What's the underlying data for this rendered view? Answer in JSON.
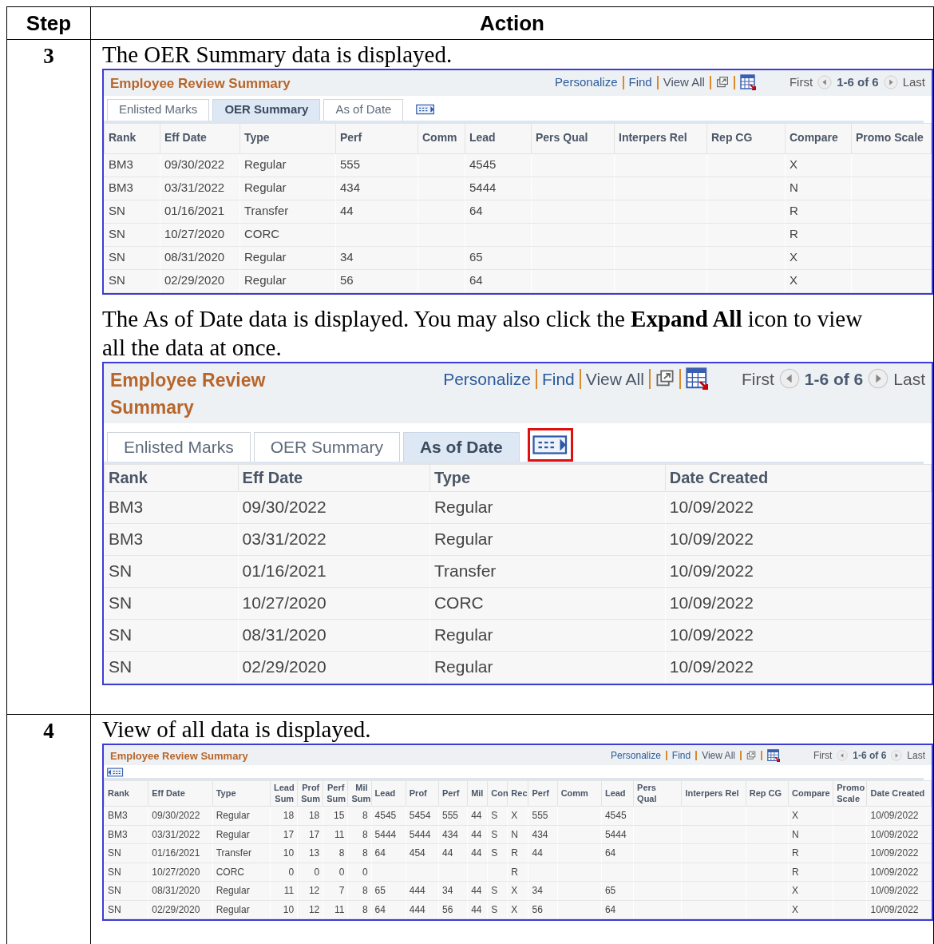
{
  "table": {
    "columns": [
      "Step",
      "Action"
    ],
    "rows": [
      {
        "step": "3",
        "content": [
          {
            "kind": "text",
            "text": "The OER Summary data is displayed."
          },
          {
            "kind": "grid",
            "title": "Employee Review Summary",
            "links": [
              "Personalize",
              "Find",
              "View All"
            ],
            "pager": {
              "first": "First",
              "range": "1-6 of 6",
              "last": "Last"
            },
            "tabs": [
              {
                "label": "Enlisted Marks",
                "selected": false
              },
              {
                "label": "OER Summary",
                "selected": true
              },
              {
                "label": "As of Date",
                "selected": false
              }
            ],
            "expand_highlighted": false,
            "columns": [
              {
                "label": "Rank"
              },
              {
                "label": "Eff Date"
              },
              {
                "label": "Type"
              },
              {
                "label": "Perf"
              },
              {
                "label": "Comm"
              },
              {
                "label": "Lead"
              },
              {
                "label": "Pers Qual"
              },
              {
                "label": "Interpers Rel"
              },
              {
                "label": "Rep CG"
              },
              {
                "label": "Compare"
              },
              {
                "label": "Promo Scale"
              }
            ],
            "rows": [
              [
                "BM3",
                "09/30/2022",
                "Regular",
                "555",
                null,
                "4545",
                null,
                null,
                null,
                "X",
                null
              ],
              [
                "BM3",
                "03/31/2022",
                "Regular",
                "434",
                null,
                "5444",
                null,
                null,
                null,
                "N",
                null
              ],
              [
                "SN",
                "01/16/2021",
                "Transfer",
                "44",
                null,
                "64",
                null,
                null,
                null,
                "R",
                null
              ],
              [
                "SN",
                "10/27/2020",
                "CORC",
                null,
                null,
                null,
                null,
                null,
                null,
                "R",
                null
              ],
              [
                "SN",
                "08/31/2020",
                "Regular",
                "34",
                null,
                "65",
                null,
                null,
                null,
                "X",
                null
              ],
              [
                "SN",
                "02/29/2020",
                "Regular",
                "56",
                null,
                "64",
                null,
                null,
                null,
                "X",
                null
              ]
            ]
          },
          {
            "kind": "text",
            "text": "The As of Date data is displayed. You may also click the **Expand All** icon to view all the data at once."
          },
          {
            "kind": "grid",
            "title": "Employee Review Summary",
            "links": [
              "Personalize",
              "Find",
              "View All"
            ],
            "pager": {
              "first": "First",
              "range": "1-6 of 6",
              "last": "Last"
            },
            "tabs": [
              {
                "label": "Enlisted Marks",
                "selected": false
              },
              {
                "label": "OER Summary",
                "selected": false
              },
              {
                "label": "As of Date",
                "selected": true
              }
            ],
            "expand_highlighted": true,
            "columns": [
              {
                "label": "Rank"
              },
              {
                "label": "Eff Date"
              },
              {
                "label": "Type"
              },
              {
                "label": "Date Created"
              }
            ],
            "rows": [
              [
                "BM3",
                "09/30/2022",
                "Regular",
                "10/09/2022"
              ],
              [
                "BM3",
                "03/31/2022",
                "Regular",
                "10/09/2022"
              ],
              [
                "SN",
                "01/16/2021",
                "Transfer",
                "10/09/2022"
              ],
              [
                "SN",
                "10/27/2020",
                "CORC",
                "10/09/2022"
              ],
              [
                "SN",
                "08/31/2020",
                "Regular",
                "10/09/2022"
              ],
              [
                "SN",
                "02/29/2020",
                "Regular",
                "10/09/2022"
              ]
            ]
          }
        ]
      },
      {
        "step": "4",
        "content": [
          {
            "kind": "text",
            "text": "View of all data is displayed."
          },
          {
            "kind": "grid",
            "title": "Employee Review Summary",
            "links": [
              "Personalize",
              "Find",
              "View All"
            ],
            "pager": {
              "first": "First",
              "range": "1-6 of 6",
              "last": "Last"
            },
            "columns": [
              {
                "label": "Rank"
              },
              {
                "label": "Eff Date"
              },
              {
                "label": "Type"
              },
              {
                "label": "Lead Sum"
              },
              {
                "label": "Prof Sum"
              },
              {
                "label": "Perf Sum"
              },
              {
                "label": "Mil Sum"
              },
              {
                "label": "Lead"
              },
              {
                "label": "Prof"
              },
              {
                "label": "Perf"
              },
              {
                "label": "Mil"
              },
              {
                "label": "Con"
              },
              {
                "label": "Rec"
              },
              {
                "label": "Perf"
              },
              {
                "label": "Comm"
              },
              {
                "label": "Lead"
              },
              {
                "label": "Pers Qual"
              },
              {
                "label": "Interpers Rel"
              },
              {
                "label": "Rep CG"
              },
              {
                "label": "Compare"
              },
              {
                "label": "Promo Scale"
              },
              {
                "label": "Date Created"
              }
            ],
            "rows": [
              [
                "BM3",
                "09/30/2022",
                "Regular",
                "18",
                "18",
                "15",
                "8",
                "4545",
                "5454",
                "555",
                "44",
                "S",
                "X",
                "555",
                null,
                "4545",
                null,
                null,
                null,
                "X",
                null,
                "10/09/2022"
              ],
              [
                "BM3",
                "03/31/2022",
                "Regular",
                "17",
                "17",
                "11",
                "8",
                "5444",
                "5444",
                "434",
                "44",
                "S",
                "N",
                "434",
                null,
                "5444",
                null,
                null,
                null,
                "N",
                null,
                "10/09/2022"
              ],
              [
                "SN",
                "01/16/2021",
                "Transfer",
                "10",
                "13",
                "8",
                "8",
                "64",
                "454",
                "44",
                "44",
                "S",
                "R",
                "44",
                null,
                "64",
                null,
                null,
                null,
                "R",
                null,
                "10/09/2022"
              ],
              [
                "SN",
                "10/27/2020",
                "CORC",
                "0",
                "0",
                "0",
                "0",
                null,
                null,
                null,
                null,
                null,
                "R",
                null,
                null,
                null,
                null,
                null,
                null,
                "R",
                null,
                "10/09/2022"
              ],
              [
                "SN",
                "08/31/2020",
                "Regular",
                "11",
                "12",
                "7",
                "8",
                "65",
                "444",
                "34",
                "44",
                "S",
                "X",
                "34",
                null,
                "65",
                null,
                null,
                null,
                "X",
                null,
                "10/09/2022"
              ],
              [
                "SN",
                "02/29/2020",
                "Regular",
                "10",
                "12",
                "11",
                "8",
                "64",
                "444",
                "56",
                "44",
                "S",
                "X",
                "56",
                null,
                "64",
                null,
                null,
                null,
                "X",
                null,
                "10/09/2022"
              ]
            ]
          }
        ]
      }
    ]
  }
}
